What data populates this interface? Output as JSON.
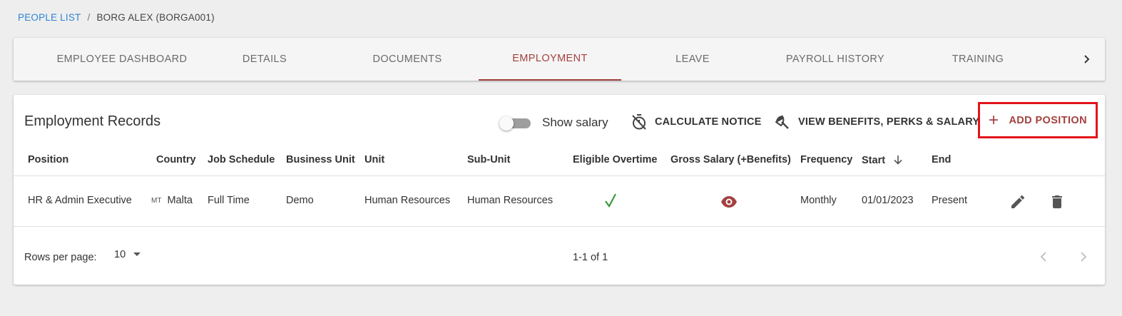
{
  "breadcrumb": {
    "parent": "PEOPLE LIST",
    "separator": "/",
    "current": "BORG ALEX (BORGA001)"
  },
  "tabs": [
    {
      "label": "EMPLOYEE DASHBOARD"
    },
    {
      "label": "DETAILS"
    },
    {
      "label": "DOCUMENTS"
    },
    {
      "label": "EMPLOYMENT",
      "active": true
    },
    {
      "label": "LEAVE"
    },
    {
      "label": "PAYROLL HISTORY"
    },
    {
      "label": "TRAINING"
    }
  ],
  "section": {
    "title": "Employment Records",
    "show_salary_label": "Show salary",
    "show_salary_on": false,
    "calculate_notice_label": "CALCULATE NOTICE",
    "view_benefits_label": "VIEW BENEFITS, PERKS & SALARY",
    "add_position_label": "ADD POSITION"
  },
  "table": {
    "columns": [
      "Position",
      "Country",
      "Job Schedule",
      "Business Unit",
      "Unit",
      "Sub-Unit",
      "Eligible Overtime",
      "Gross Salary (+Benefits)",
      "Frequency",
      "Start",
      "End"
    ],
    "sorted_column": "Start",
    "rows": [
      {
        "position": "HR & Admin Executive",
        "country_code": "MT",
        "country": "Malta",
        "job_schedule": "Full Time",
        "business_unit": "Demo",
        "unit": "Human Resources",
        "sub_unit": "Human Resources",
        "eligible_overtime": "check-icon",
        "gross_salary": "eye-icon",
        "frequency": "Monthly",
        "start": "01/01/2023",
        "end": "Present"
      }
    ]
  },
  "footer": {
    "rows_per_page_label": "Rows per page:",
    "rows_per_page_value": "10",
    "range": "1-1 of 1"
  },
  "colors": {
    "accent": "#a3413f",
    "link": "#2d84d4",
    "highlight": "#e3141a",
    "check": "#3d9a3d"
  }
}
